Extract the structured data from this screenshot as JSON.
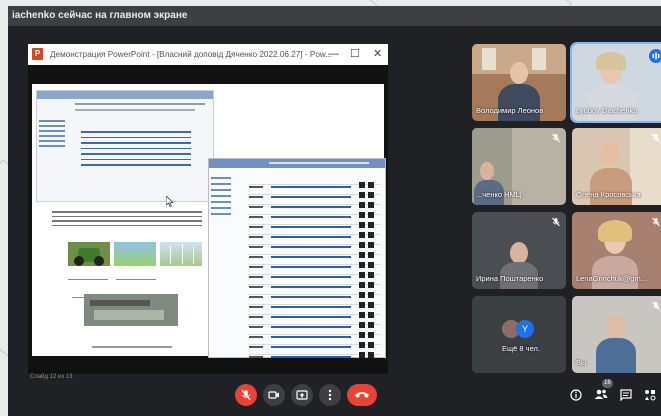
{
  "banner": {
    "text": "iachenko сейчас на главном экране"
  },
  "presentation": {
    "window_title": "Демонстрация PowerPoint - [Власний доповід Дяченко 2022.06.27] - Pow...",
    "app_icon": "P",
    "status": "Слайд 12 из 13",
    "minimize": "—",
    "maximize": "☐",
    "close": "✕"
  },
  "participants": [
    {
      "name": "Володимир Леонов",
      "muted": false
    },
    {
      "name": "Lyubov Diachenko",
      "muted": false,
      "speaking": true
    },
    {
      "name": "...ченко НМЦ",
      "muted": true
    },
    {
      "name": "Олена Кросовська",
      "muted": true
    },
    {
      "name": "Ирина Поштаренко",
      "muted": true
    },
    {
      "name": "LenaGrinchuk@gm...",
      "muted": true
    },
    {
      "name": "Ещё 8 чел.",
      "avatar_letter": "Y"
    },
    {
      "name": "Вы",
      "muted": true
    }
  ],
  "controls": {
    "mic_icon": "mic-off-icon",
    "camera_icon": "camera-icon",
    "present_icon": "present-icon",
    "more_icon": "more-icon",
    "end_icon": "end-call-icon"
  },
  "right_controls": {
    "info_icon": "info-icon",
    "people_badge": "16"
  },
  "colors": {
    "bg": "#202124",
    "end": "#ea4335",
    "accent": "#1a73e8"
  }
}
